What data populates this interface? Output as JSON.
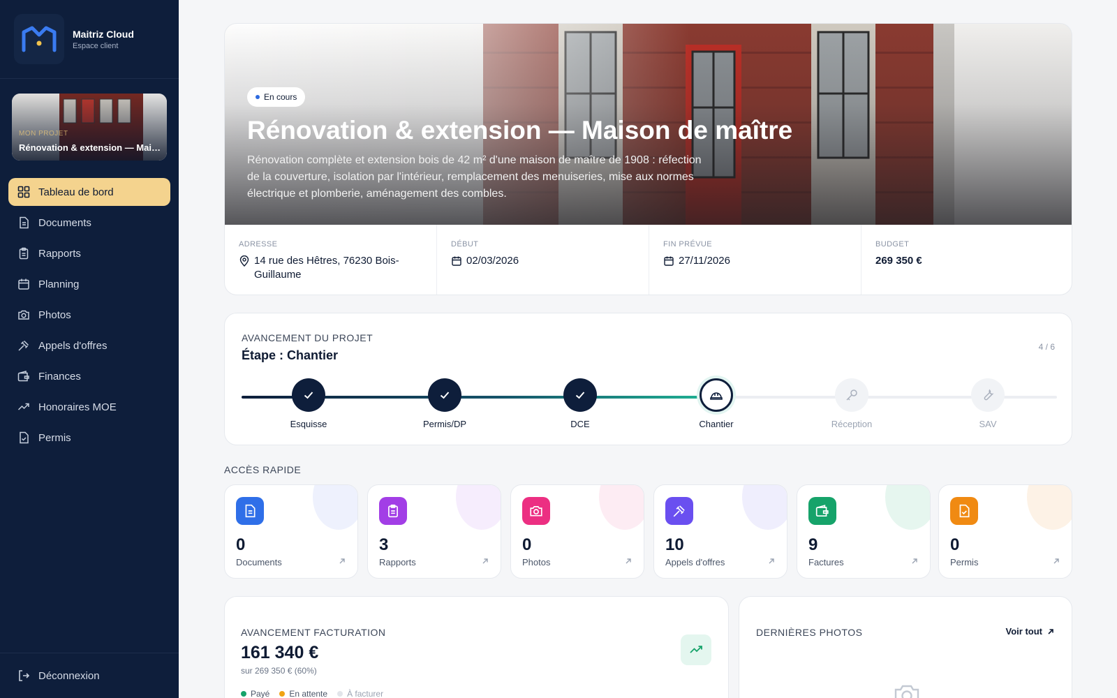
{
  "brand": {
    "name": "Maitriz Cloud",
    "subtitle": "Espace client"
  },
  "project_card": {
    "label": "MON PROJET",
    "title": "Rénovation & extension — Maison de maître"
  },
  "nav": [
    {
      "label": "Tableau de bord",
      "icon": "dashboard-icon",
      "active": true
    },
    {
      "label": "Documents",
      "icon": "document-icon"
    },
    {
      "label": "Rapports",
      "icon": "clipboard-icon"
    },
    {
      "label": "Planning",
      "icon": "calendar-icon"
    },
    {
      "label": "Photos",
      "icon": "camera-icon"
    },
    {
      "label": "Appels d'offres",
      "icon": "gavel-icon"
    },
    {
      "label": "Finances",
      "icon": "wallet-icon"
    },
    {
      "label": "Honoraires MOE",
      "icon": "trend-icon"
    },
    {
      "label": "Permis",
      "icon": "file-check-icon"
    }
  ],
  "logout": {
    "label": "Déconnexion"
  },
  "hero": {
    "status": "En cours",
    "title": "Rénovation & extension — Maison de maître",
    "description": "Rénovation complète et extension bois de 42 m² d'une maison de maître de 1908 : réfection de la couverture, isolation par l'intérieur, remplacement des menuiseries, mise aux normes électrique et plomberie, aménagement des combles.",
    "address_label": "ADRESSE",
    "address": "14 rue des Hêtres, 76230 Bois-Guillaume",
    "start_label": "DÉBUT",
    "start": "02/03/2026",
    "end_label": "FIN PRÉVUE",
    "end": "27/11/2026",
    "budget_label": "BUDGET",
    "budget": "269 350 €"
  },
  "progress": {
    "label": "AVANCEMENT DU PROJET",
    "stage": "Étape : Chantier",
    "count": "4 / 6",
    "steps": [
      {
        "name": "Esquisse",
        "state": "done",
        "icon": "check-icon"
      },
      {
        "name": "Permis/DP",
        "state": "done",
        "icon": "check-icon"
      },
      {
        "name": "DCE",
        "state": "done",
        "icon": "check-icon"
      },
      {
        "name": "Chantier",
        "state": "current",
        "icon": "hard-hat-icon"
      },
      {
        "name": "Réception",
        "state": "todo",
        "icon": "key-icon"
      },
      {
        "name": "SAV",
        "state": "todo",
        "icon": "wrench-icon"
      }
    ]
  },
  "quick_access": {
    "title": "ACCÈS RAPIDE",
    "cards": [
      {
        "count": "0",
        "label": "Documents",
        "icon": "document-icon",
        "color": "#2f6fe8",
        "tint": "#eef1fd"
      },
      {
        "count": "3",
        "label": "Rapports",
        "icon": "clipboard-icon",
        "color": "#a23ee6",
        "tint": "#f6edfd"
      },
      {
        "count": "0",
        "label": "Photos",
        "icon": "camera-icon",
        "color": "#ec2f82",
        "tint": "#fdecf3"
      },
      {
        "count": "10",
        "label": "Appels d'offres",
        "icon": "gavel-icon",
        "color": "#6a4ff0",
        "tint": "#efeefd"
      },
      {
        "count": "9",
        "label": "Factures",
        "icon": "wallet-icon",
        "color": "#16a36a",
        "tint": "#e6f6ef"
      },
      {
        "count": "0",
        "label": "Permis",
        "icon": "file-check-icon",
        "color": "#f08a12",
        "tint": "#fdf2e6"
      }
    ]
  },
  "billing": {
    "label": "AVANCEMENT FACTURATION",
    "amount": "161 340 €",
    "subtitle": "sur 269 350 € (60%)",
    "legend": [
      {
        "label": "Payé",
        "color": "#16a36a"
      },
      {
        "label": "En attente",
        "color": "#f0a312"
      },
      {
        "label": "À facturer",
        "color": "#e2e5ea"
      }
    ]
  },
  "photos": {
    "label": "DERNIÈRES PHOTOS",
    "link": "Voir tout"
  }
}
